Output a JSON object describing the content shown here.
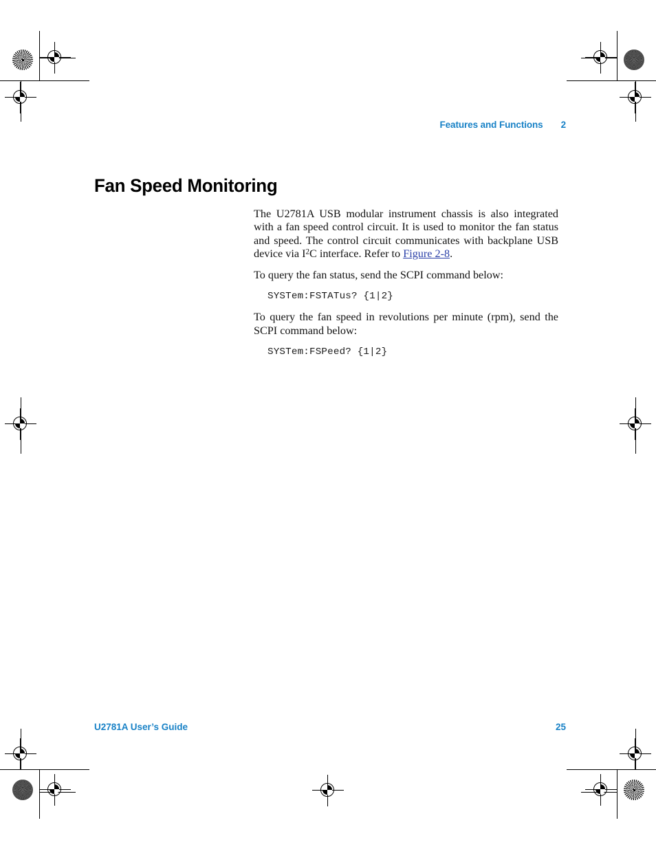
{
  "document": {
    "running_header": {
      "chapter_title": "Features and Functions",
      "chapter_number": "2"
    },
    "heading": "Fan Speed Monitoring",
    "body": {
      "paragraph_1_part_1": "The U2781A USB modular instrument chassis is also integrated with a fan speed control circuit. It is used to monitor the fan status and speed. The control circuit communicates with backplane USB device via I",
      "paragraph_1_superscript": "2",
      "paragraph_1_part_2": "C interface. Refer to ",
      "paragraph_1_xref": "Figure 2-8",
      "paragraph_1_part_3": ".",
      "paragraph_2": "To query the fan status, send the SCPI command below:",
      "code_1": "SYSTem:FSTATus? {1|2}",
      "paragraph_3": "To query the fan speed in revolutions per minute (rpm), send the SCPI command below:",
      "code_2": "SYSTem:FSPeed? {1|2}"
    },
    "footer": {
      "guide_title": "U2781A User’s Guide",
      "page_number": "25"
    },
    "colors": {
      "header_blue": "#1781C6",
      "xref_blue": "#2B40A8",
      "text_black": "#111111",
      "registration_black": "#000000",
      "density_gray": "#4a4a4a"
    },
    "print_marks": {
      "star_target_top_left": "star-target",
      "density_dot_top_right": "density-dot",
      "density_dot_bottom_left": "density-dot",
      "star_target_bottom_right": "star-target",
      "registration_mark": "registration-crosshair"
    }
  }
}
